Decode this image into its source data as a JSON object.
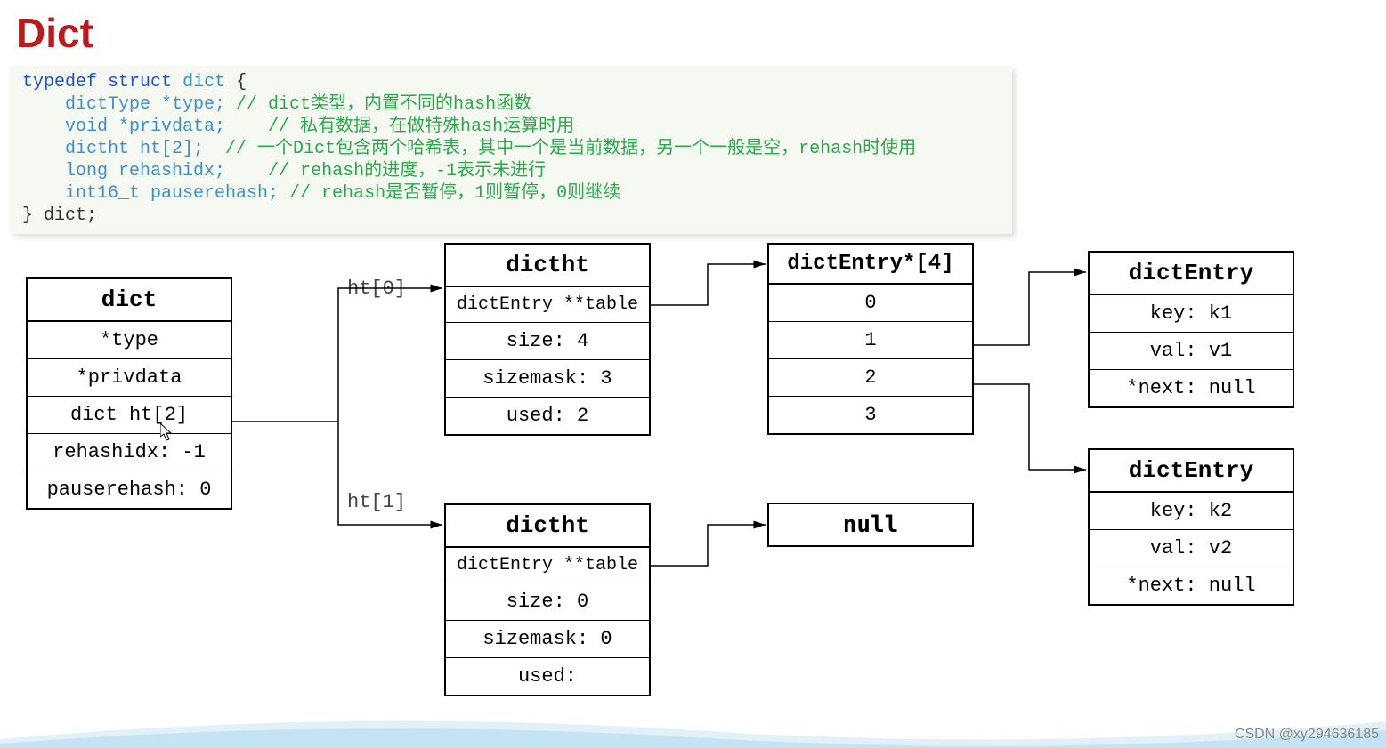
{
  "title": "Dict",
  "code": {
    "l1_kw1": "typedef",
    "l1_kw2": "struct",
    "l1_id": "dict",
    "l1_tail": " {",
    "l2_t": "    dictType *type;",
    "l2_c": " // dict类型，内置不同的hash函数",
    "l3_t": "    void *privdata;",
    "l3_c": "    // 私有数据，在做特殊hash运算时用",
    "l4_t": "    dictht ht[2];",
    "l4_c": "  // 一个Dict包含两个哈希表，其中一个是当前数据，另一个一般是空，rehash时使用",
    "l5_t": "    long rehashidx;",
    "l5_c": "    // rehash的进度，-1表示未进行",
    "l6_t": "    int16_t pauserehash;",
    "l6_c": " // rehash是否暂停，1则暂停，0则继续",
    "l7": "} dict;"
  },
  "labels": {
    "ht0": "ht[0]",
    "ht1": "ht[1]"
  },
  "dict_box": {
    "head": "dict",
    "r0": "*type",
    "r1": "*privdata",
    "r2": "dict ht[2]",
    "r3": "rehashidx: -1",
    "r4": "pauserehash: 0"
  },
  "dictht0": {
    "head": "dictht",
    "r0": "dictEntry **table",
    "r1": "size: 4",
    "r2": "sizemask: 3",
    "r3": "used:  2"
  },
  "dictht1": {
    "head": "dictht",
    "r0": "dictEntry **table",
    "r1": "size: 0",
    "r2": "sizemask: 0",
    "r3": "used:"
  },
  "array_box": {
    "head": "dictEntry*[4]",
    "r0": "0",
    "r1": "1",
    "r2": "2",
    "r3": "3"
  },
  "null_box": {
    "head": "null"
  },
  "entry1": {
    "head": "dictEntry",
    "r0": "key: k1",
    "r1": "val: v1",
    "r2": "*next: null"
  },
  "entry2": {
    "head": "dictEntry",
    "r0": "key: k2",
    "r1": "val: v2",
    "r2": "*next: null"
  },
  "watermark": "CSDN @xy294636185"
}
